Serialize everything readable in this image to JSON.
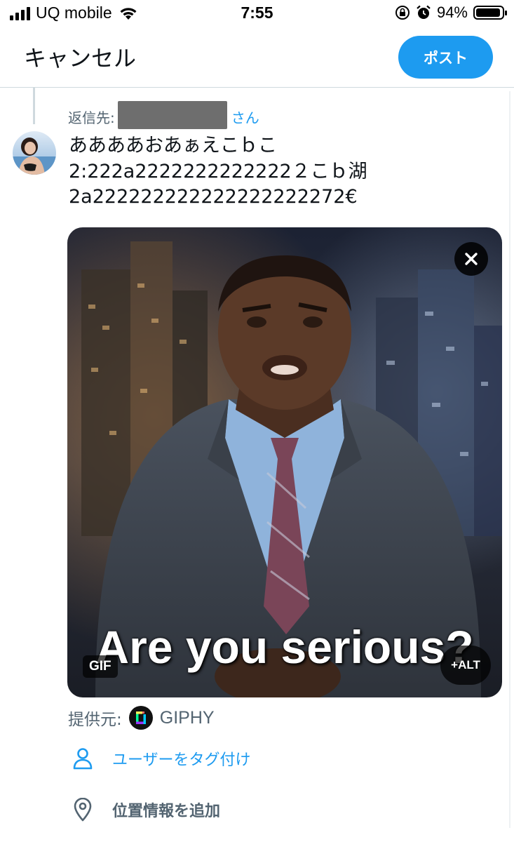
{
  "status_bar": {
    "carrier": "UQ mobile",
    "time": "7:55",
    "battery_pct": "94%",
    "battery_level": 0.94
  },
  "header": {
    "cancel_label": "キャンセル",
    "post_label": "ポスト"
  },
  "reply": {
    "prefix": "返信先:",
    "suffix": "さん"
  },
  "tweet": {
    "lines": [
      "ああああおあぁえこｂこ",
      "2:222a2222222222222２こｂ湖",
      "2a222222222222222222272€"
    ]
  },
  "media": {
    "caption": "Are you serious?",
    "gif_badge": "GIF",
    "alt_badge": "+ALT"
  },
  "provider": {
    "prefix": "提供元:",
    "name": "GIPHY"
  },
  "actions": {
    "tag_users": "ユーザーをタグ付け",
    "add_location": "位置情報を追加"
  },
  "colors": {
    "accent": "#1d9bf0",
    "secondary_text": "#536471"
  }
}
